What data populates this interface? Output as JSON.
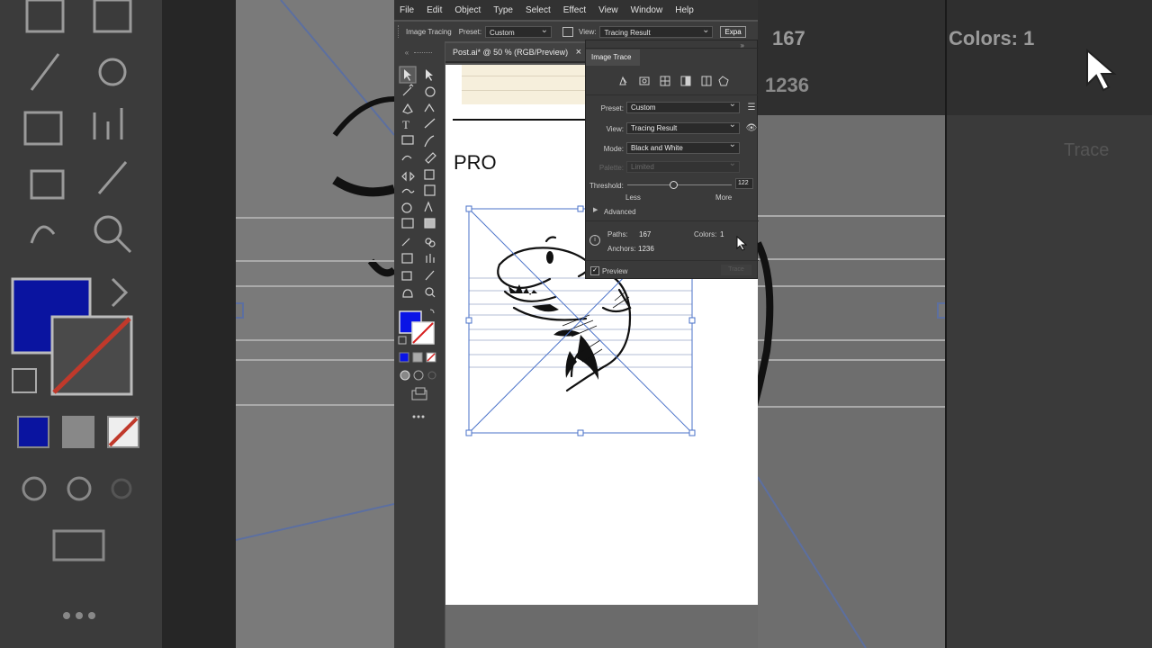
{
  "menu": [
    "File",
    "Edit",
    "Object",
    "Type",
    "Select",
    "Effect",
    "View",
    "Window",
    "Help"
  ],
  "control_bar": {
    "label": "Image Tracing",
    "preset_label": "Preset:",
    "preset_value": "Custom",
    "view_label": "View:",
    "view_value": "Tracing Result",
    "expand_button": "Expa"
  },
  "document_tab": {
    "title": "Post.ai* @ 50 % (RGB/Preview)",
    "close": "×"
  },
  "canvas": {
    "heading": "PRO"
  },
  "colors": {
    "fill": "#0a14e6",
    "ui_dark": "#323232",
    "panel_bg": "#3a3a3a"
  },
  "panel": {
    "title": "Image Trace",
    "preset_label": "Preset:",
    "preset_value": "Custom",
    "view_label": "View:",
    "view_value": "Tracing Result",
    "mode_label": "Mode:",
    "mode_value": "Black and White",
    "palette_label": "Palette:",
    "palette_value": "Limited",
    "threshold_label": "Threshold:",
    "threshold_value": "122",
    "threshold_fraction": 0.45,
    "less": "Less",
    "more": "More",
    "advanced": "Advanced",
    "paths_label": "Paths:",
    "paths_value": "167",
    "colors_label": "Colors:",
    "colors_value": "1",
    "anchors_label": "Anchors:",
    "anchors_value": "1236",
    "preview_label": "Preview",
    "preview_checked": true,
    "trace_button": "Trace"
  },
  "background": {
    "paths_value": "167",
    "colors_text": "Colors:  1",
    "anchors_value": "1236",
    "trace_text": "Trace"
  }
}
